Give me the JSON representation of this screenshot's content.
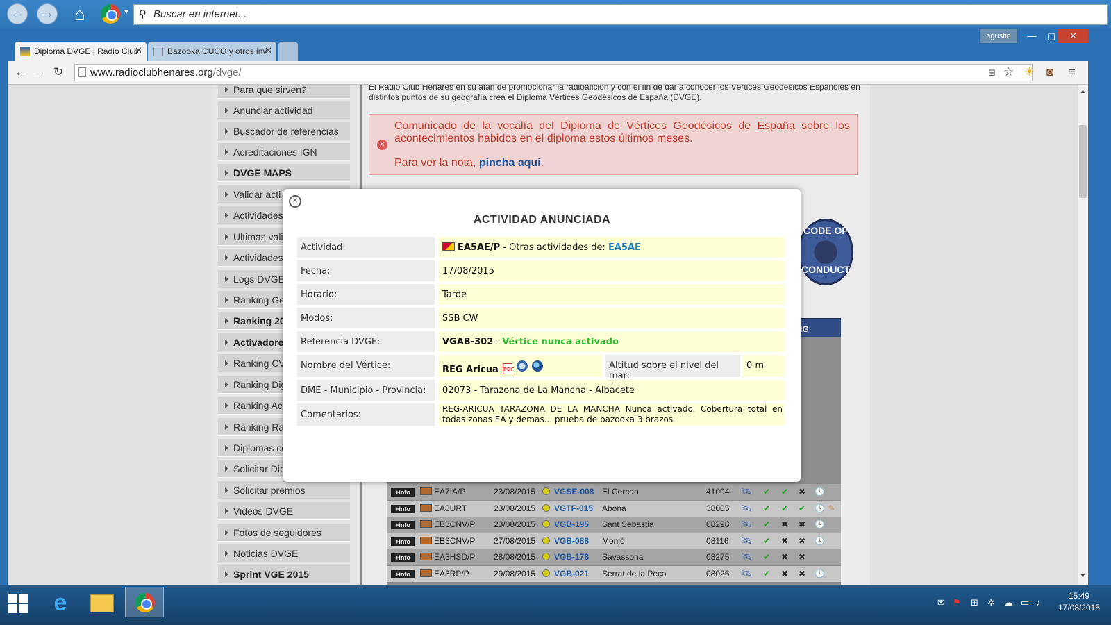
{
  "topbar": {
    "search_placeholder": "Buscar en internet..."
  },
  "browser": {
    "tabs": [
      {
        "title": "Diploma DVGE | Radio Club"
      },
      {
        "title": "Bazooka CUCO y otros inv"
      }
    ],
    "user": "agustin",
    "url": {
      "domain": "www.radioclubhenares.org",
      "path": "/dvge/"
    }
  },
  "sidebar": {
    "items": [
      {
        "label": "Para que sirven?"
      },
      {
        "label": "Anunciar actividad"
      },
      {
        "label": "Buscador de referencias"
      },
      {
        "label": "Acreditaciones IGN"
      },
      {
        "label": "DVGE MAPS"
      },
      {
        "label": "Validar acti"
      },
      {
        "label": "Actividades"
      },
      {
        "label": "Ultimas vali"
      },
      {
        "label": "Actividades"
      },
      {
        "label": "Logs DVGE"
      },
      {
        "label": "Ranking Ge"
      },
      {
        "label": "Ranking 20"
      },
      {
        "label": "Activadore"
      },
      {
        "label": "Ranking CV"
      },
      {
        "label": "Ranking Dig"
      },
      {
        "label": "Ranking Ac"
      },
      {
        "label": "Ranking Ra"
      },
      {
        "label": "Diplomas co"
      },
      {
        "label": "Solicitar Dip"
      },
      {
        "label": "Solicitar premios"
      },
      {
        "label": "Videos DVGE"
      },
      {
        "label": "Fotos de seguidores"
      },
      {
        "label": "Noticias DVGE"
      },
      {
        "label": "Sprint VGE 2015"
      }
    ]
  },
  "content": {
    "intro": "El Radio Club Henares en su afán de promocionar la radioafición y con el fin de dar a conocer los Vértices Geodésicos Españoles en distintos puntos de su geografía crea el Diploma Vértices Geodésicos de España (DVGE).",
    "alert": {
      "text": "Comunicado de la vocalía del Diploma de Vértices Geodésicos de España sobre los acontecimientos habidos en el diploma estos últimos meses.",
      "note_prefix": "Para ver la nota, ",
      "link": "pincha aqui",
      "note_suffix": "."
    },
    "badge": {
      "line1": "CODE OF",
      "line2": "CONDUCT"
    },
    "table_header_fragment": "IG",
    "rows": [
      {
        "info": "+info",
        "call": "EA7IA/P",
        "date": "23/08/2015",
        "ref": "VGSE-008",
        "place": "El Cercao",
        "code": "41004",
        "i2": "✔",
        "i3": "✔",
        "i4": "✖",
        "i5": "🕓",
        "i6": ""
      },
      {
        "info": "+info",
        "call": "EA8URT",
        "date": "23/08/2015",
        "ref": "VGTF-015",
        "place": "Abona",
        "code": "38005",
        "i2": "✔",
        "i3": "✔",
        "i4": "✔",
        "i5": "🕓",
        "i6": "✎"
      },
      {
        "info": "+info",
        "call": "EB3CNV/P",
        "date": "23/08/2015",
        "ref": "VGB-195",
        "place": "Sant Sebastia",
        "code": "08298",
        "i2": "✔",
        "i3": "✖",
        "i4": "✖",
        "i5": "🕓",
        "i6": ""
      },
      {
        "info": "+info",
        "call": "EB3CNV/P",
        "date": "27/08/2015",
        "ref": "VGB-088",
        "place": "Monjó",
        "code": "08116",
        "i2": "✔",
        "i3": "✖",
        "i4": "✖",
        "i5": "🕓",
        "i6": ""
      },
      {
        "info": "+info",
        "call": "EA3HSD/P",
        "date": "28/08/2015",
        "ref": "VGB-178",
        "place": "Savassona",
        "code": "08275",
        "i2": "✔",
        "i3": "✖",
        "i4": "✖",
        "i5": "",
        "i6": ""
      },
      {
        "info": "+info",
        "call": "EA3RP/P",
        "date": "29/08/2015",
        "ref": "VGB-021",
        "place": "Serrat de la Peça",
        "code": "08026",
        "i2": "✔",
        "i3": "✖",
        "i4": "✖",
        "i5": "🕓",
        "i6": ""
      }
    ]
  },
  "modal": {
    "title": "ACTIVIDAD ANUNCIADA",
    "actividad_label": "Actividad:",
    "actividad_call": "EA5AE/P",
    "actividad_sep": " - Otras actividades de: ",
    "actividad_link": "EA5AE",
    "fecha_label": "Fecha:",
    "fecha": "17/08/2015",
    "horario_label": "Horario:",
    "horario": "Tarde",
    "modos_label": "Modos:",
    "modos": "SSB CW",
    "referencia_label": "Referencia DVGE:",
    "referencia": "VGAB-302",
    "referencia_sep": " - ",
    "referencia_status": "Vértice nunca activado",
    "vertice_label": "Nombre del Vértice:",
    "vertice": "REG Aricua",
    "altitud_label": "Altitud sobre el nivel del mar:",
    "altitud": "0 m",
    "dme_label": "DME - Municipio - Provincia:",
    "dme": "02073 - Tarazona de La Mancha - Albacete",
    "comentarios_label": "Comentarios:",
    "comentarios": "REG-ARICUA TARAZONA DE LA MANCHA Nunca activado. Cobertura total en todas zonas EA y demas... prueba de bazooka 3 brazos"
  },
  "taskbar": {
    "time": "15:49",
    "date": "17/08/2015"
  }
}
